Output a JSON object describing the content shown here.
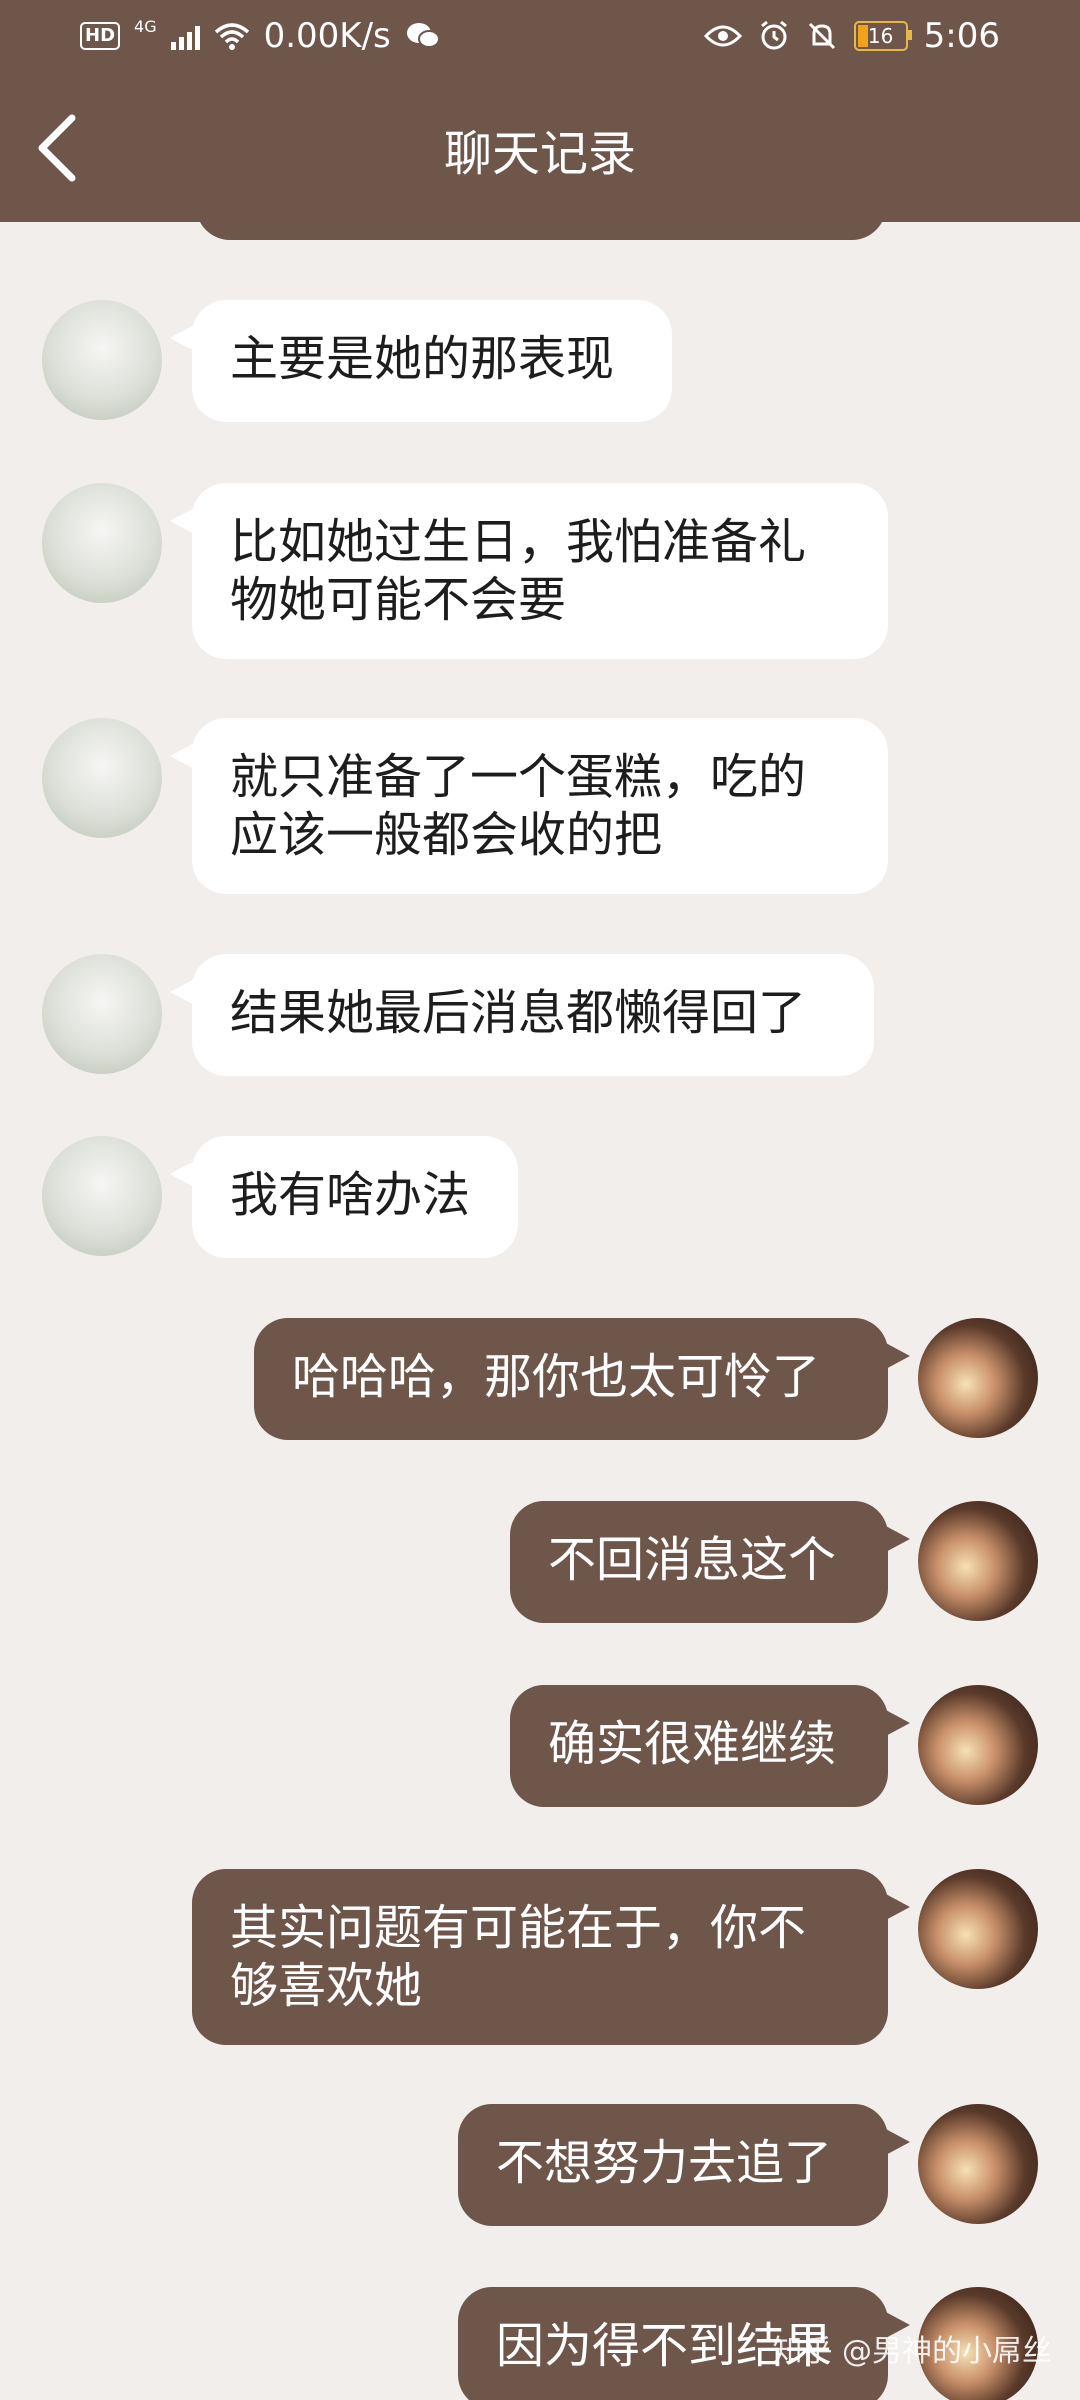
{
  "status_bar": {
    "network": "4G",
    "speed": "0.00K/s",
    "battery": "16",
    "time": "5:06"
  },
  "header": {
    "title": "聊天记录"
  },
  "messages": [
    {
      "side": "in",
      "text": "主要是她的那表现"
    },
    {
      "side": "in",
      "text": "比如她过生日，我怕准备礼物她可能不会要"
    },
    {
      "side": "in",
      "text": "就只准备了一个蛋糕，吃的应该一般都会收的把"
    },
    {
      "side": "in",
      "text": "结果她最后消息都懒得回了"
    },
    {
      "side": "in",
      "text": "我有啥办法"
    },
    {
      "side": "out",
      "text": "哈哈哈，那你也太可怜了"
    },
    {
      "side": "out",
      "text": "不回消息这个"
    },
    {
      "side": "out",
      "text": "确实很难继续"
    },
    {
      "side": "out",
      "text": "其实问题有可能在于，你不够喜欢她"
    },
    {
      "side": "out",
      "text": "不想努力去追了"
    },
    {
      "side": "out",
      "text": "因为得不到结果"
    }
  ],
  "watermark": "知乎 @男神的小屌丝",
  "colors": {
    "brand": "#6f564b",
    "background": "#f1eeec",
    "incoming_bubble": "#ffffff"
  }
}
